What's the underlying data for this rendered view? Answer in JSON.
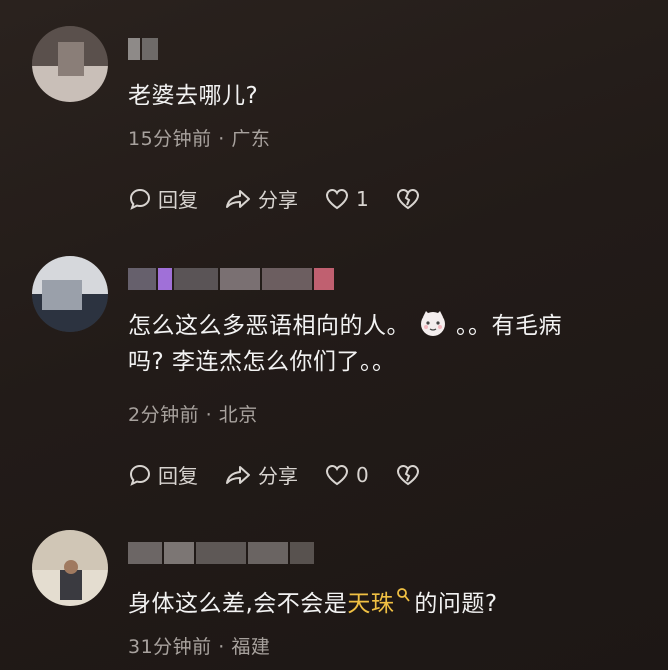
{
  "comments": [
    {
      "text": "老婆去哪儿?",
      "time": "15分钟前",
      "location": "广东",
      "reply_label": "回复",
      "share_label": "分享",
      "likes": "1"
    },
    {
      "text_part1": "怎么这么多恶语相向的人。",
      "text_part2": "。。有毛病",
      "text_line2": "吗? 李连杰怎么你们了。。",
      "time": "2分钟前",
      "location": "北京",
      "reply_label": "回复",
      "share_label": "分享",
      "likes": "0"
    },
    {
      "text_prefix": "身体这么差,会不会是",
      "text_keyword": "天珠",
      "text_suffix": "的问题?",
      "time": "31分钟前",
      "location": "福建"
    }
  ],
  "separator": " · ",
  "colors": {
    "keyword": "#f0c043",
    "meta": "#a8a29e"
  }
}
